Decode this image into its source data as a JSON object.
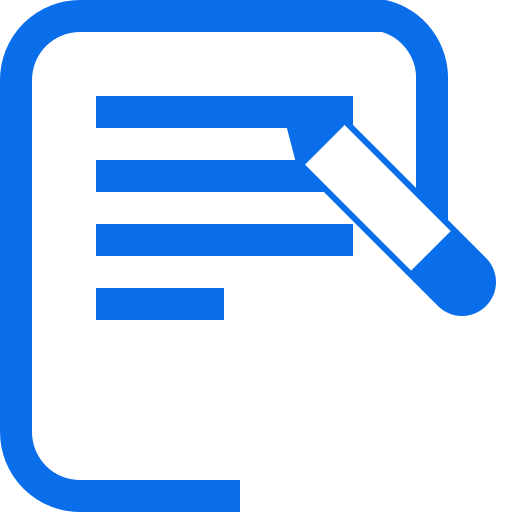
{
  "icon": {
    "name": "edit-document-icon",
    "parts": [
      "document-icon",
      "text-lines",
      "pencil-icon"
    ],
    "accent_color": "#0A6EEB",
    "background_color": "#FFFFFF"
  }
}
